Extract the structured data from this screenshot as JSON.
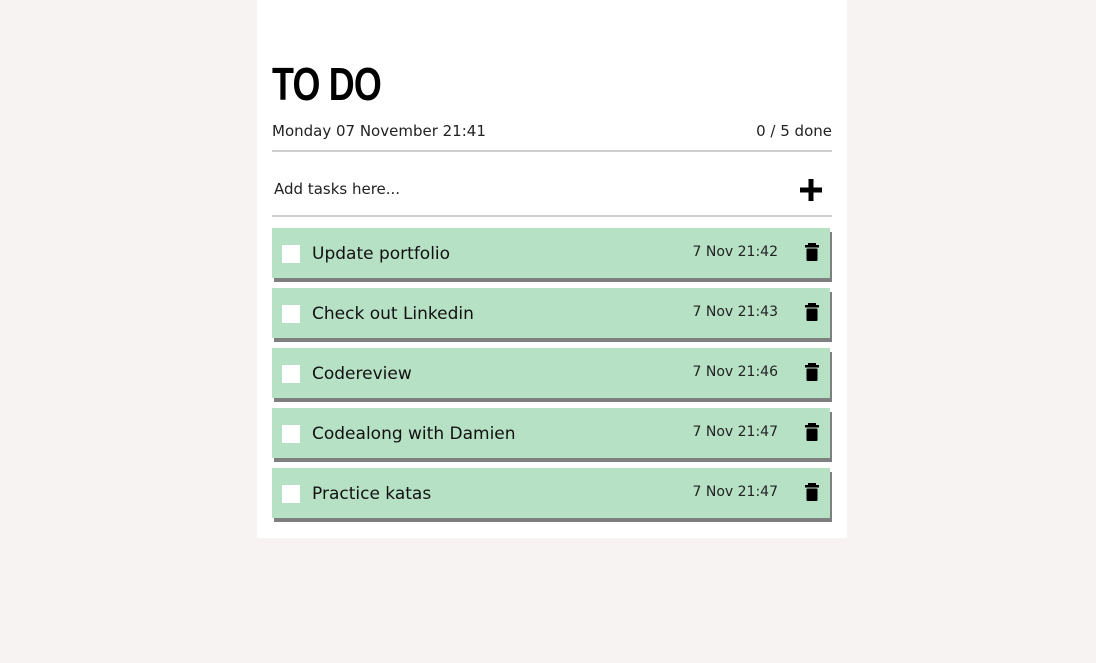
{
  "header": {
    "title": "TO DO",
    "current_datetime": "Monday 07 November 21:41",
    "done_summary": "0 / 5 done"
  },
  "add_task": {
    "placeholder": "Add tasks here...",
    "button_icon": "plus-icon"
  },
  "tasks": [
    {
      "label": "Update portfolio",
      "time": "7 Nov 21:42",
      "done": false
    },
    {
      "label": "Check out Linkedin",
      "time": "7 Nov 21:43",
      "done": false
    },
    {
      "label": "Codereview",
      "time": "7 Nov 21:46",
      "done": false
    },
    {
      "label": "Codealong with Damien",
      "time": "7 Nov 21:47",
      "done": false
    },
    {
      "label": "Practice katas",
      "time": "7 Nov 21:47",
      "done": false
    }
  ],
  "colors": {
    "page_background": "#f7f3f2",
    "card_background": "#ffffff",
    "task_background": "#b7e1c5",
    "task_shadow": "#7f7f7f"
  },
  "icons": {
    "delete": "trash-icon",
    "checkbox": "checkbox-unchecked"
  }
}
